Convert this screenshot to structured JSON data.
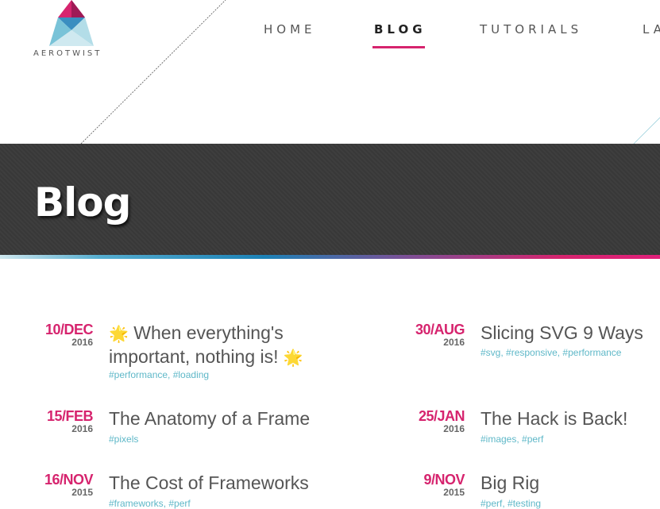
{
  "brand": {
    "name": "AEROTWIST"
  },
  "nav": {
    "items": [
      {
        "label": "HOME"
      },
      {
        "label": "BLOG"
      },
      {
        "label": "TUTORIALS"
      },
      {
        "label": "LA"
      }
    ],
    "active_index": 1
  },
  "banner": {
    "title": "Blog"
  },
  "colors": {
    "accent": "#d6246e",
    "tag": "#5fb8c8",
    "banner_bg": "#383838"
  },
  "posts": [
    {
      "day_month": "10/DEC",
      "year": "2016",
      "title_line1": "When everything's",
      "title_line2": "important, nothing is!",
      "title_prefix_icon": "🌟",
      "title_suffix_icon": "🌟",
      "tags": [
        "#performance",
        "#loading"
      ]
    },
    {
      "day_month": "30/AUG",
      "year": "2016",
      "title": "Slicing SVG 9 Ways",
      "tags": [
        "#svg",
        "#responsive",
        "#performance"
      ]
    },
    {
      "day_month": "15/FEB",
      "year": "2016",
      "title": "The Anatomy of a Frame",
      "tags": [
        "#pixels"
      ]
    },
    {
      "day_month": "25/JAN",
      "year": "2016",
      "title": "The Hack is Back!",
      "tags": [
        "#images",
        "#perf"
      ]
    },
    {
      "day_month": "16/NOV",
      "year": "2015",
      "title": "The Cost of Frameworks",
      "tags": [
        "#frameworks",
        "#perf"
      ]
    },
    {
      "day_month": "9/NOV",
      "year": "2015",
      "title": "Big Rig",
      "tags": [
        "#perf",
        "#testing"
      ]
    }
  ]
}
